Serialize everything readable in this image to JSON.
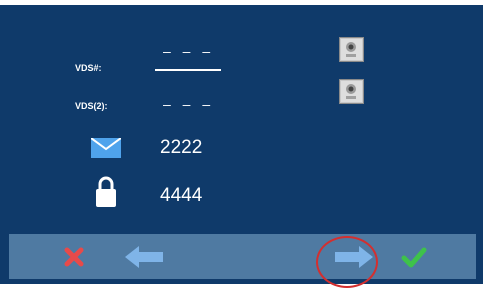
{
  "fields": {
    "vds_label": "VDS#:",
    "vds_value": "– – –",
    "vds2_label": "VDS(2):",
    "vds2_value": "– – –",
    "mail_value": "2222",
    "lock_value": "4444"
  },
  "icons": {
    "mail": "envelope-icon",
    "lock": "padlock-icon",
    "door_station_1": "door-station-icon",
    "door_station_2": "door-station-icon"
  },
  "toolbar": {
    "cancel": "close-icon",
    "back": "arrow-left-icon",
    "next": "arrow-right-icon",
    "confirm": "checkmark-icon"
  },
  "colors": {
    "background": "#0f3a6a",
    "toolbar": "#4f7aa2",
    "highlight": "#d32f2f"
  }
}
